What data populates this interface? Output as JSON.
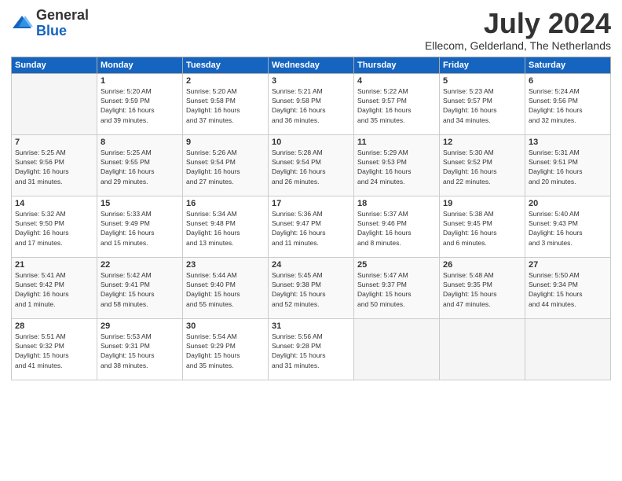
{
  "logo": {
    "general": "General",
    "blue": "Blue"
  },
  "title": "July 2024",
  "location": "Ellecom, Gelderland, The Netherlands",
  "days_header": [
    "Sunday",
    "Monday",
    "Tuesday",
    "Wednesday",
    "Thursday",
    "Friday",
    "Saturday"
  ],
  "weeks": [
    [
      {
        "day": "",
        "info": ""
      },
      {
        "day": "1",
        "info": "Sunrise: 5:20 AM\nSunset: 9:59 PM\nDaylight: 16 hours\nand 39 minutes."
      },
      {
        "day": "2",
        "info": "Sunrise: 5:20 AM\nSunset: 9:58 PM\nDaylight: 16 hours\nand 37 minutes."
      },
      {
        "day": "3",
        "info": "Sunrise: 5:21 AM\nSunset: 9:58 PM\nDaylight: 16 hours\nand 36 minutes."
      },
      {
        "day": "4",
        "info": "Sunrise: 5:22 AM\nSunset: 9:57 PM\nDaylight: 16 hours\nand 35 minutes."
      },
      {
        "day": "5",
        "info": "Sunrise: 5:23 AM\nSunset: 9:57 PM\nDaylight: 16 hours\nand 34 minutes."
      },
      {
        "day": "6",
        "info": "Sunrise: 5:24 AM\nSunset: 9:56 PM\nDaylight: 16 hours\nand 32 minutes."
      }
    ],
    [
      {
        "day": "7",
        "info": "Sunrise: 5:25 AM\nSunset: 9:56 PM\nDaylight: 16 hours\nand 31 minutes."
      },
      {
        "day": "8",
        "info": "Sunrise: 5:25 AM\nSunset: 9:55 PM\nDaylight: 16 hours\nand 29 minutes."
      },
      {
        "day": "9",
        "info": "Sunrise: 5:26 AM\nSunset: 9:54 PM\nDaylight: 16 hours\nand 27 minutes."
      },
      {
        "day": "10",
        "info": "Sunrise: 5:28 AM\nSunset: 9:54 PM\nDaylight: 16 hours\nand 26 minutes."
      },
      {
        "day": "11",
        "info": "Sunrise: 5:29 AM\nSunset: 9:53 PM\nDaylight: 16 hours\nand 24 minutes."
      },
      {
        "day": "12",
        "info": "Sunrise: 5:30 AM\nSunset: 9:52 PM\nDaylight: 16 hours\nand 22 minutes."
      },
      {
        "day": "13",
        "info": "Sunrise: 5:31 AM\nSunset: 9:51 PM\nDaylight: 16 hours\nand 20 minutes."
      }
    ],
    [
      {
        "day": "14",
        "info": "Sunrise: 5:32 AM\nSunset: 9:50 PM\nDaylight: 16 hours\nand 17 minutes."
      },
      {
        "day": "15",
        "info": "Sunrise: 5:33 AM\nSunset: 9:49 PM\nDaylight: 16 hours\nand 15 minutes."
      },
      {
        "day": "16",
        "info": "Sunrise: 5:34 AM\nSunset: 9:48 PM\nDaylight: 16 hours\nand 13 minutes."
      },
      {
        "day": "17",
        "info": "Sunrise: 5:36 AM\nSunset: 9:47 PM\nDaylight: 16 hours\nand 11 minutes."
      },
      {
        "day": "18",
        "info": "Sunrise: 5:37 AM\nSunset: 9:46 PM\nDaylight: 16 hours\nand 8 minutes."
      },
      {
        "day": "19",
        "info": "Sunrise: 5:38 AM\nSunset: 9:45 PM\nDaylight: 16 hours\nand 6 minutes."
      },
      {
        "day": "20",
        "info": "Sunrise: 5:40 AM\nSunset: 9:43 PM\nDaylight: 16 hours\nand 3 minutes."
      }
    ],
    [
      {
        "day": "21",
        "info": "Sunrise: 5:41 AM\nSunset: 9:42 PM\nDaylight: 16 hours\nand 1 minute."
      },
      {
        "day": "22",
        "info": "Sunrise: 5:42 AM\nSunset: 9:41 PM\nDaylight: 15 hours\nand 58 minutes."
      },
      {
        "day": "23",
        "info": "Sunrise: 5:44 AM\nSunset: 9:40 PM\nDaylight: 15 hours\nand 55 minutes."
      },
      {
        "day": "24",
        "info": "Sunrise: 5:45 AM\nSunset: 9:38 PM\nDaylight: 15 hours\nand 52 minutes."
      },
      {
        "day": "25",
        "info": "Sunrise: 5:47 AM\nSunset: 9:37 PM\nDaylight: 15 hours\nand 50 minutes."
      },
      {
        "day": "26",
        "info": "Sunrise: 5:48 AM\nSunset: 9:35 PM\nDaylight: 15 hours\nand 47 minutes."
      },
      {
        "day": "27",
        "info": "Sunrise: 5:50 AM\nSunset: 9:34 PM\nDaylight: 15 hours\nand 44 minutes."
      }
    ],
    [
      {
        "day": "28",
        "info": "Sunrise: 5:51 AM\nSunset: 9:32 PM\nDaylight: 15 hours\nand 41 minutes."
      },
      {
        "day": "29",
        "info": "Sunrise: 5:53 AM\nSunset: 9:31 PM\nDaylight: 15 hours\nand 38 minutes."
      },
      {
        "day": "30",
        "info": "Sunrise: 5:54 AM\nSunset: 9:29 PM\nDaylight: 15 hours\nand 35 minutes."
      },
      {
        "day": "31",
        "info": "Sunrise: 5:56 AM\nSunset: 9:28 PM\nDaylight: 15 hours\nand 31 minutes."
      },
      {
        "day": "",
        "info": ""
      },
      {
        "day": "",
        "info": ""
      },
      {
        "day": "",
        "info": ""
      }
    ]
  ]
}
